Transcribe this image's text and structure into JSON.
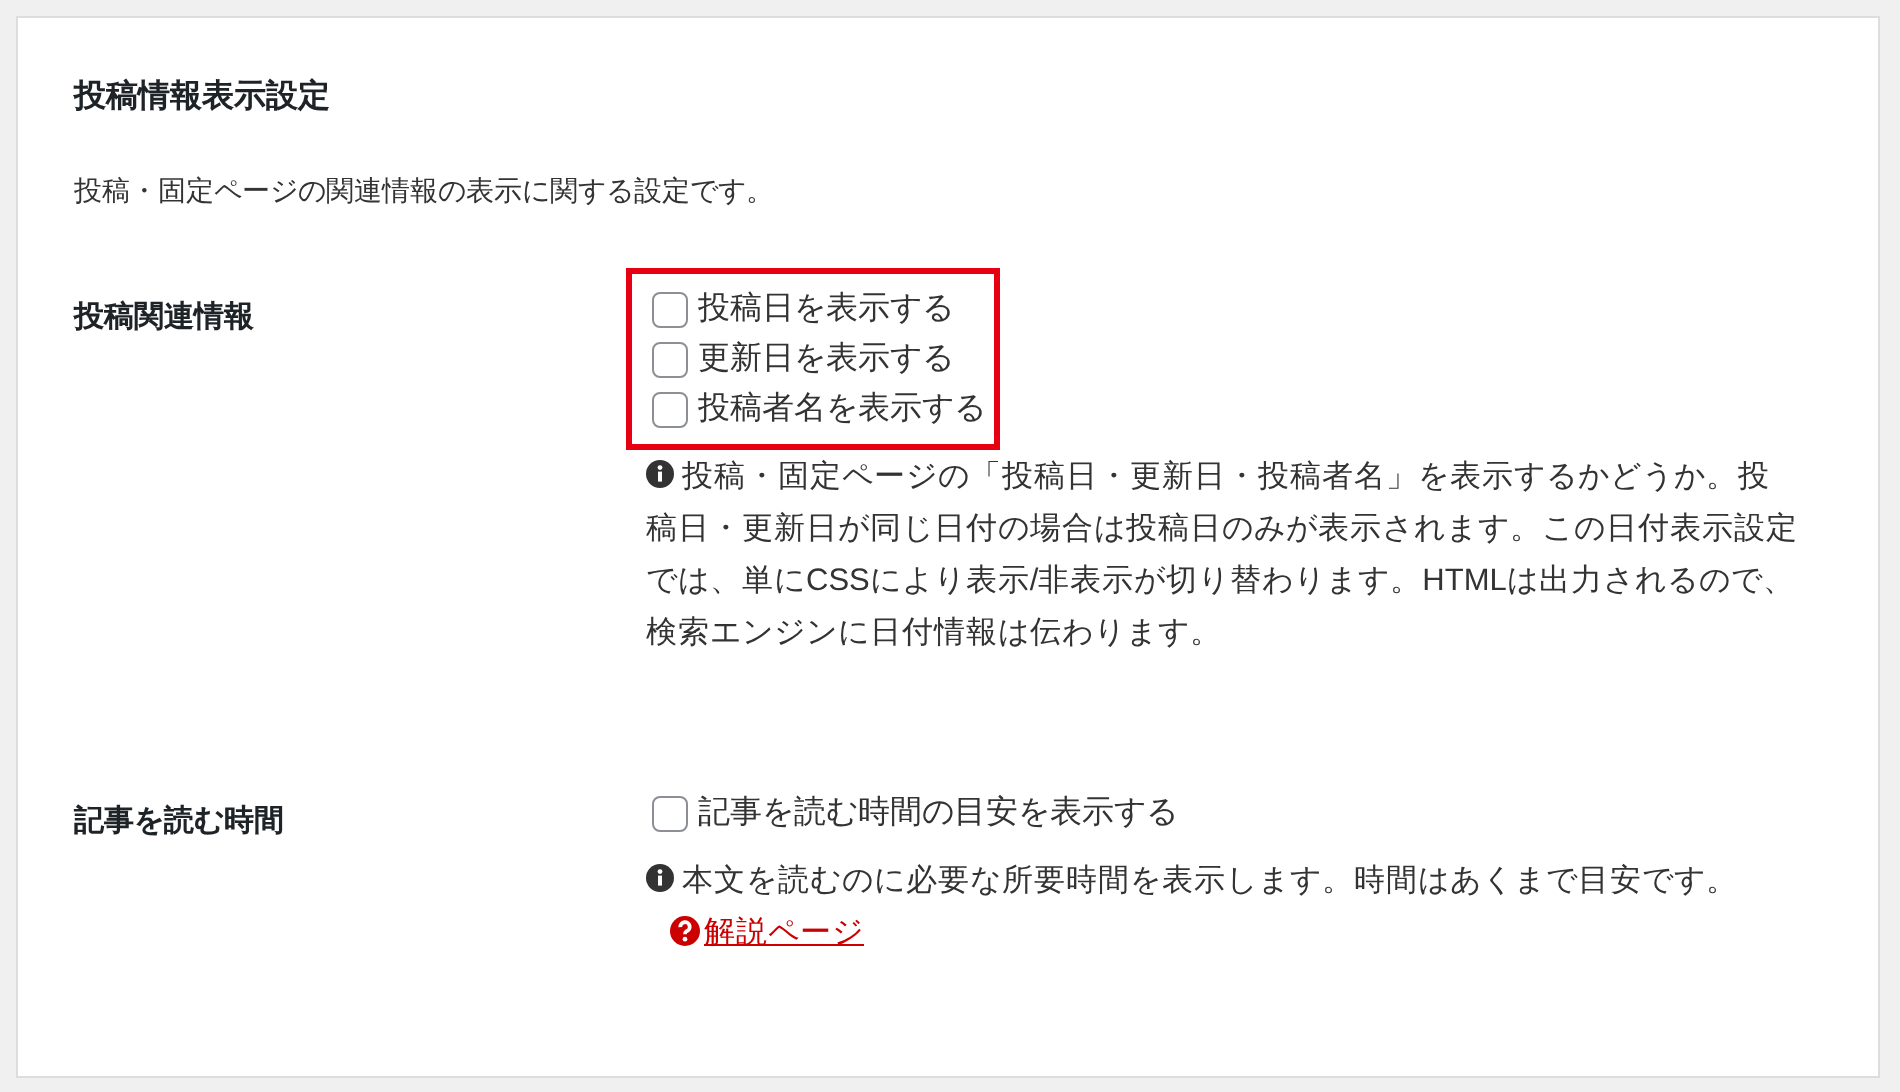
{
  "section": {
    "title": "投稿情報表示設定",
    "description": "投稿・固定ページの関連情報の表示に関する設定です。"
  },
  "settings": [
    {
      "label": "投稿関連情報",
      "highlighted": true,
      "options": [
        {
          "label": "投稿日を表示する",
          "checked": false
        },
        {
          "label": "更新日を表示する",
          "checked": false
        },
        {
          "label": "投稿者名を表示する",
          "checked": false
        }
      ],
      "help": {
        "text": "投稿・固定ページの「投稿日・更新日・投稿者名」を表示するかどうか。投稿日・更新日が同じ日付の場合は投稿日のみが表示されます。この日付表示設定では、単にCSSにより表示/非表示が切り替わります。HTMLは出力されるので、検索エンジンに日付情報は伝わります。"
      }
    },
    {
      "label": "記事を読む時間",
      "highlighted": false,
      "options": [
        {
          "label": "記事を読む時間の目安を表示する",
          "checked": false
        }
      ],
      "help": {
        "text": "本文を読むのに必要な所要時間を表示します。時間はあくまで目安です。",
        "link": "解説ページ"
      }
    }
  ]
}
